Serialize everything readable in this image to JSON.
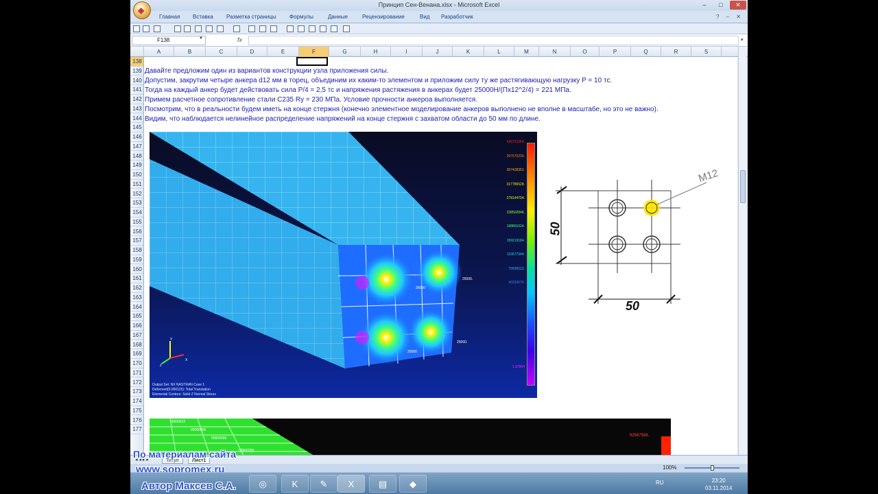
{
  "window": {
    "title": "Принцип Сен-Венана.xlsx - Microsoft Excel",
    "controls": {
      "minimize": "–",
      "maximize": "□",
      "close": "✕"
    }
  },
  "ribbon": {
    "tabs": [
      "Главная",
      "Вставка",
      "Разметка страницы",
      "Формулы",
      "Данные",
      "Рецензирование",
      "Вид",
      "Разработчик"
    ],
    "right_icons": "? – ✕"
  },
  "formula_bar": {
    "name_box": "F138",
    "fx": "fx",
    "value": ""
  },
  "columns": [
    "A",
    "B",
    "C",
    "D",
    "E",
    "F",
    "G",
    "H",
    "I",
    "J",
    "K",
    "L",
    "M",
    "N",
    "O",
    "P",
    "Q",
    "R",
    "S"
  ],
  "selected_column": "F",
  "rows": [
    "138",
    "139",
    "140",
    "141",
    "142",
    "143",
    "144",
    "145",
    "146",
    "147",
    "148",
    "149",
    "150",
    "151",
    "152",
    "153",
    "154",
    "155",
    "156",
    "157",
    "158",
    "159",
    "160",
    "161",
    "162",
    "163",
    "164",
    "165",
    "166",
    "167",
    "168",
    "169",
    "170",
    "171",
    "172",
    "173",
    "174",
    "175",
    "176",
    "177"
  ],
  "text_lines": [
    "Давайте предложим один из вариантов конструкции узла приложения силы.",
    "Допустим, закрутим четыре анкера  d12 мм в торец, объединим их каким-то элементом и приложим силу ту же растягивающую нагрузку P = 10 тс.",
    "Тогда на каждый анкер будет действовать сила P/4 = 2,5 тс и напряжения растяжения в анкерах будет 25000Н/(Пх12^2/4) = 221 МПа.",
    "Примем расчетное сопротивление стали С235 Ry = 230 МПа. Условие прочности анкероа выполняется.",
    "Посмотрим, что в реальности будем иметь на конце стержня (конечно элементное моделирование анкеров выполнено не вполне в масштабе, но это не важно).",
    "Видим, что наблюдается нелинейное распределение напряжений на конце стержня с захватом  области до 50 мм по длине."
  ],
  "fea": {
    "legend": [
      "436721264.",
      "397670209.",
      "357428352.",
      "317786528.",
      "278144704.",
      "238502848.",
      "198861024.",
      "159219184.",
      "119577344.",
      "79935512.",
      "40293676.",
      "",
      "",
      "",
      "",
      "",
      "1.97854"
    ],
    "legend_colors": [
      "#ff2020",
      "#ff7a20",
      "#ffb400",
      "#ffe000",
      "#d8ff20",
      "#8aff40",
      "#40ff80",
      "#20f0c0",
      "#20d8ff",
      "#40b0ff",
      "#3a7bff",
      "#2a4cff",
      "#2a30ff",
      "#5a20ff",
      "#9a20ff",
      "#d020ff",
      "#ff20ff"
    ],
    "labels": [
      "25000.",
      "25000",
      "25000.",
      "25000"
    ],
    "notes": [
      "Output Set: NX NASTRAN Case 1",
      "Deformed(0.000115): Total Translation",
      "Elemental Contour: Solid Z Normal Stress"
    ],
    "axes": [
      "Y",
      "Z",
      "X"
    ]
  },
  "sketch": {
    "dim_vertical": "50",
    "dim_horizontal": "50",
    "anchor_label": "M12"
  },
  "fea2": {
    "value": "92567568.",
    "labels": [
      "00000012",
      "00000056",
      "00000036",
      "00000200"
    ]
  },
  "sheet_tabs": [
    "Титул",
    "Лист1"
  ],
  "nav_arrows": "◂ ◂ ▸ ▸",
  "status": {
    "zoom": "100%"
  },
  "watermark": {
    "line1": "По материалам сайта",
    "line2": "www.sopromex.ru",
    "line3": "Автор Максев С.А."
  },
  "taskbar": {
    "icons": [
      "❖",
      "◎",
      "K",
      "✎",
      "X",
      "▤",
      "◆"
    ],
    "lang": "RU",
    "time": "23:20",
    "date": "03.11.2014"
  },
  "colors": {
    "text_blue": "#1a1fae",
    "selected_column": "#f6cd74",
    "mesh": "#3ad0ff"
  }
}
